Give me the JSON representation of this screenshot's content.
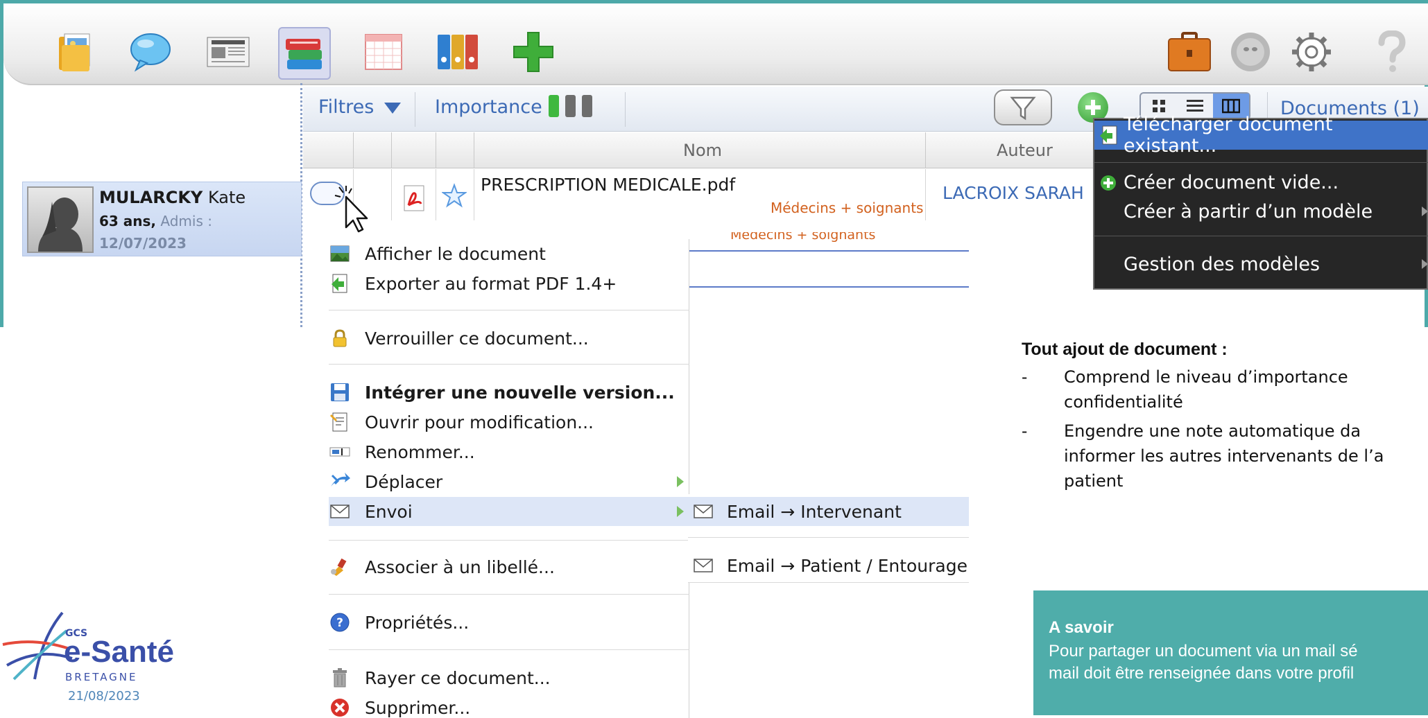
{
  "toolbar": {
    "icons": [
      "folder-photos-icon",
      "chat-bubble-icon",
      "newspaper-icon",
      "books-icon",
      "calendar-icon",
      "binders-icon",
      "add-plus-icon",
      "briefcase-icon",
      "avatar-bubble-icon",
      "settings-gear-icon",
      "help-question-icon"
    ]
  },
  "patient": {
    "last_name": "MULARCKY",
    "first_name": "Kate",
    "age": "63 ans,",
    "admis_label": "Admis :",
    "admis_date": "12/07/2023"
  },
  "filter_bar": {
    "filtres": "Filtres",
    "importance": "Importance",
    "documents": "Documents (1)",
    "colors": {
      "green": "#3fb83f",
      "gray": "#6d6d6d"
    }
  },
  "table": {
    "col_nom": "Nom",
    "col_auteur": "Auteur",
    "row": {
      "name": "PRESCRIPTION MEDICALE.pdf",
      "audience": "Médecins + soignants",
      "author": "LACROIX SARAH"
    },
    "ghost_audience": "Médecins + soignants"
  },
  "context_menu": {
    "items": [
      {
        "label": "Afficher le document"
      },
      {
        "label": "Exporter au format PDF 1.4+"
      },
      {
        "label": "Verrouiller ce document..."
      },
      {
        "label": "Intégrer une nouvelle version..."
      },
      {
        "label": "Ouvrir pour modification..."
      },
      {
        "label": "Renommer..."
      },
      {
        "label": "Déplacer"
      },
      {
        "label": "Envoi"
      },
      {
        "label": "Associer à un libellé..."
      },
      {
        "label": "Propriétés..."
      },
      {
        "label": "Rayer ce document..."
      },
      {
        "label": "Supprimer..."
      }
    ]
  },
  "submenu": {
    "email_intervenant": "Email → Intervenant",
    "email_patient": "Email → Patient / Entourage"
  },
  "dark_menu": {
    "telecharger": "Télécharger document existant...",
    "creer_vide": "Créer document vide...",
    "creer_modele": "Créer à partir d’un modèle",
    "gestion": "Gestion des modèles"
  },
  "notes": {
    "title": "Tout ajout de document :",
    "dash": "-",
    "line1a": "Comprend   le   niveau   d’importance",
    "line1b": "confidentialité",
    "line2a": "Engendre   une   note   automatique   da",
    "line2b": "informer  les  autres  intervenants  de  l’a",
    "line2c": "patient"
  },
  "info_box": {
    "title": "A savoir",
    "line1": "Pour partager un document via un mail sé",
    "line2": "mail doit être renseignée dans votre profil"
  },
  "logo": {
    "gcs": "GCS",
    "brand": "e-Santé",
    "region": "BRETAGNE",
    "date": "21/08/2023"
  }
}
